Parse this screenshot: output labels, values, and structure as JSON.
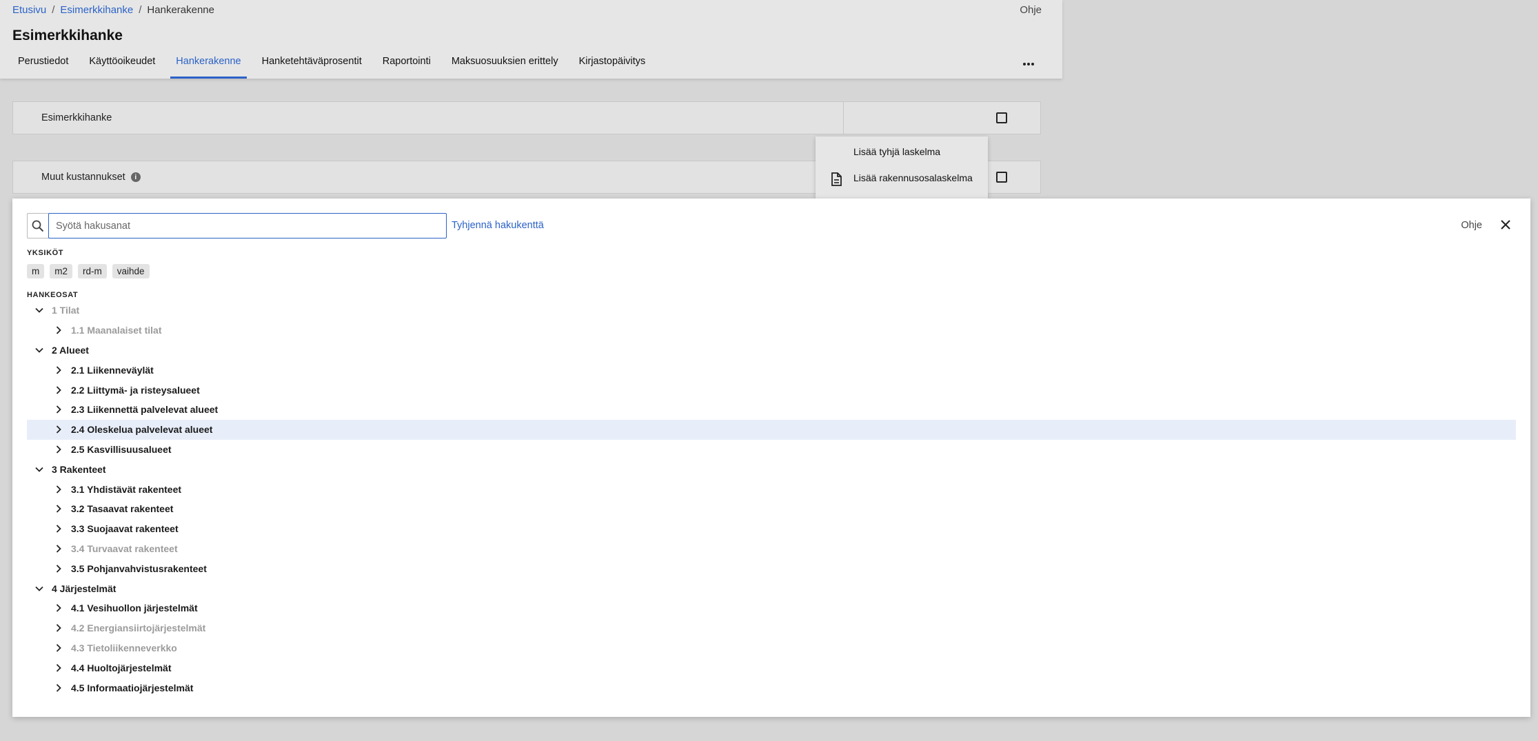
{
  "breadcrumb": {
    "home": "Etusivu",
    "project": "Esimerkkihanke",
    "current": "Hankerakenne",
    "separator": "/"
  },
  "header": {
    "help": "Ohje",
    "title": "Esimerkkihanke",
    "tabs": [
      {
        "label": "Perustiedot"
      },
      {
        "label": "Käyttöoikeudet"
      },
      {
        "label": "Hankerakenne",
        "active": true
      },
      {
        "label": "Hanketehtäväprosentit"
      },
      {
        "label": "Raportointi"
      },
      {
        "label": "Maksuosuuksien erittely"
      },
      {
        "label": "Kirjastopäivitys"
      }
    ],
    "more_icon": "ellipsis-icon"
  },
  "rows": {
    "project_label": "Esimerkkihanke",
    "other_costs_label": "Muut kustannukset"
  },
  "context_menu": {
    "items": [
      {
        "label": "Lisää tyhjä laskelma"
      },
      {
        "label": "Lisää rakennusosalaskelma",
        "icon": "document-icon"
      }
    ]
  },
  "panel": {
    "search_placeholder": "Syötä hakusanat",
    "search_value": "",
    "clear_label": "Tyhjennä hakukenttä",
    "help": "Ohje",
    "units_title": "YKSIKÖT",
    "units": [
      "m",
      "m2",
      "rd-m",
      "vaihde"
    ],
    "parts_title": "HANKEOSAT",
    "tree": [
      {
        "label": "1 Tilat",
        "level": 1,
        "expanded": true,
        "disabled": true
      },
      {
        "label": "1.1 Maanalaiset tilat",
        "level": 2,
        "disabled": true
      },
      {
        "label": "2 Alueet",
        "level": 1,
        "expanded": true
      },
      {
        "label": "2.1 Liikenneväylät",
        "level": 2
      },
      {
        "label": "2.2 Liittymä- ja risteysalueet",
        "level": 2
      },
      {
        "label": "2.3 Liikennettä palvelevat alueet",
        "level": 2
      },
      {
        "label": "2.4 Oleskelua palvelevat alueet",
        "level": 2,
        "highlighted": true
      },
      {
        "label": "2.5 Kasvillisuusalueet",
        "level": 2
      },
      {
        "label": "3 Rakenteet",
        "level": 1,
        "expanded": true
      },
      {
        "label": "3.1 Yhdistävät rakenteet",
        "level": 2
      },
      {
        "label": "3.2 Tasaavat rakenteet",
        "level": 2
      },
      {
        "label": "3.3 Suojaavat rakenteet",
        "level": 2
      },
      {
        "label": "3.4 Turvaavat rakenteet",
        "level": 2,
        "disabled": true
      },
      {
        "label": "3.5 Pohjanvahvistusrakenteet",
        "level": 2
      },
      {
        "label": "4 Järjestelmät",
        "level": 1,
        "expanded": true
      },
      {
        "label": "4.1 Vesihuollon järjestelmät",
        "level": 2
      },
      {
        "label": "4.2 Energiansiirtojärjestelmät",
        "level": 2,
        "disabled": true
      },
      {
        "label": "4.3 Tietoliikenneverkko",
        "level": 2,
        "disabled": true
      },
      {
        "label": "4.4 Huoltojärjestelmät",
        "level": 2
      },
      {
        "label": "4.5 Informaatiojärjestelmät",
        "level": 2
      }
    ]
  },
  "colors": {
    "accent": "#2b62c7",
    "highlight": "#e8eef9",
    "disabled_text": "#9b9b9b"
  }
}
